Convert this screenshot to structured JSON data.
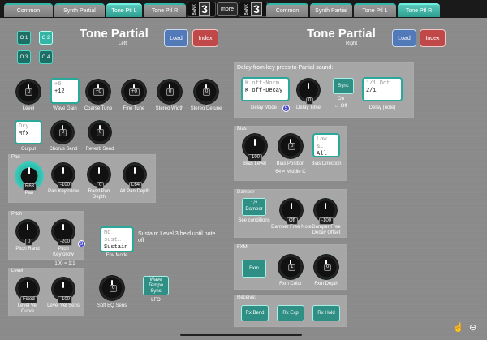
{
  "tabs_left": [
    {
      "label": "Common"
    },
    {
      "label": "Synth Partial"
    },
    {
      "label": "Tone Ptl L"
    },
    {
      "label": "Tone Ptl R"
    }
  ],
  "tabs_right": [
    {
      "label": "Common"
    },
    {
      "label": "Synth Partial"
    },
    {
      "label": "Tone Ptl L"
    },
    {
      "label": "Tone Ptl R"
    }
  ],
  "bank_left": {
    "label": "BANK",
    "value": "3"
  },
  "bank_right": {
    "label": "BANK",
    "value": "3"
  },
  "more_label": "more",
  "left": {
    "title": "Tone Partial",
    "subtitle": "Left",
    "load": "Load",
    "index": "Index",
    "osc": [
      "O 1",
      "O 2",
      "O 3",
      "O 4"
    ],
    "level": {
      "value": "0",
      "label": "Level"
    },
    "wave_gain": {
      "ghost": "+6",
      "value": "+12",
      "label": "Wave Gain"
    },
    "coarse_tune": {
      "value": "+0",
      "label": "Coarse Tune"
    },
    "fine_tune": {
      "value": "+0",
      "label": "Fine Tune"
    },
    "stereo_width": {
      "value": "0",
      "label": "Stereo Width"
    },
    "stereo_detune": {
      "value": "0",
      "label": "Stereo Detune"
    },
    "output": {
      "ghost": "Dry",
      "value": "Mfx",
      "label": "Output"
    },
    "chorus_send": {
      "value": "0",
      "label": "Chorus Send"
    },
    "reverb_send": {
      "value": "0",
      "label": "Reverb Send"
    },
    "pan_panel": {
      "title": "Pan",
      "pan": {
        "value": "R63",
        "label": "Pan"
      },
      "pan_keyfollow": {
        "value": "-100",
        "label": "Pan Keyfollow"
      },
      "rand_pan_depth": {
        "value": "0",
        "label": "Rand Pan Depth"
      },
      "alt_pan_depth": {
        "value": "L64",
        "label": "Alt Pan Depth"
      }
    },
    "pitch_panel": {
      "title": "Pitch",
      "pitch_rand": {
        "value": "0",
        "label": "Pitch Rand"
      },
      "pitch_keyfollow": {
        "value": "-200",
        "label": "Pitch Keyfollow"
      },
      "badge": "3",
      "note": "100 = 1:1"
    },
    "env_mode": {
      "ghost": "No sust…",
      "value": "Sustain",
      "label": "Env Mode",
      "note": "Sustain: Level 3 held until note off"
    },
    "level_panel": {
      "title": "Level",
      "vel_curve": {
        "value": "Fixed",
        "label": "Level Vel Curve"
      },
      "vel_sens": {
        "value": "-100",
        "label": "Level Vel Sens"
      }
    },
    "soft_eq": {
      "value": "0",
      "label": "Soft EQ Sens"
    },
    "lfo": {
      "button": "Wave Tempo Sync",
      "label": "LFO"
    }
  },
  "right": {
    "title": "Tone Partial",
    "subtitle": "Right",
    "load": "Load",
    "index": "Index",
    "delay_panel": {
      "title": "Delay from key press to Partial sound:",
      "mode": {
        "ghost": "K off-Norm",
        "value": "K off-Decay",
        "label": "Delay Mode"
      },
      "badge": "5",
      "time": {
        "value": "0",
        "label": "Delay Time"
      },
      "sync": {
        "label": "Sync",
        "on": "On",
        "off": "Off"
      },
      "note_value": {
        "ghost": "1/1 Dot",
        "value": "2/1",
        "label": "Delay (note)"
      }
    },
    "bias_panel": {
      "title": "Bias",
      "level": {
        "value": "-100",
        "label": "Bias Level"
      },
      "position": {
        "value": "0",
        "label": "Bias Position",
        "note": "64 = Middle C"
      },
      "direction": {
        "ghost": "Low &…",
        "value": "All",
        "label": "Bias Direction"
      }
    },
    "damper_panel": {
      "title": "Damper",
      "button": "1/2 Damper",
      "note": "See conditions",
      "free_note": {
        "value": "Off",
        "label": "Damper Free Note"
      },
      "decay_offset": {
        "value": "-100",
        "label": "Damper Free Decay Offset"
      }
    },
    "fxm_panel": {
      "title": "FXM",
      "button": "Fxm",
      "color": {
        "value": "1",
        "label": "Fxm Color"
      },
      "depth": {
        "value": "0",
        "label": "Fxm Depth"
      }
    },
    "receive_panel": {
      "title": "Receive:",
      "bend": "Rx Bend",
      "exp": "Rx Exp",
      "hold": "Rx Hold"
    }
  },
  "colors": {
    "accent": "#4ee0cf",
    "load": "#5279b8",
    "index": "#c04848"
  }
}
